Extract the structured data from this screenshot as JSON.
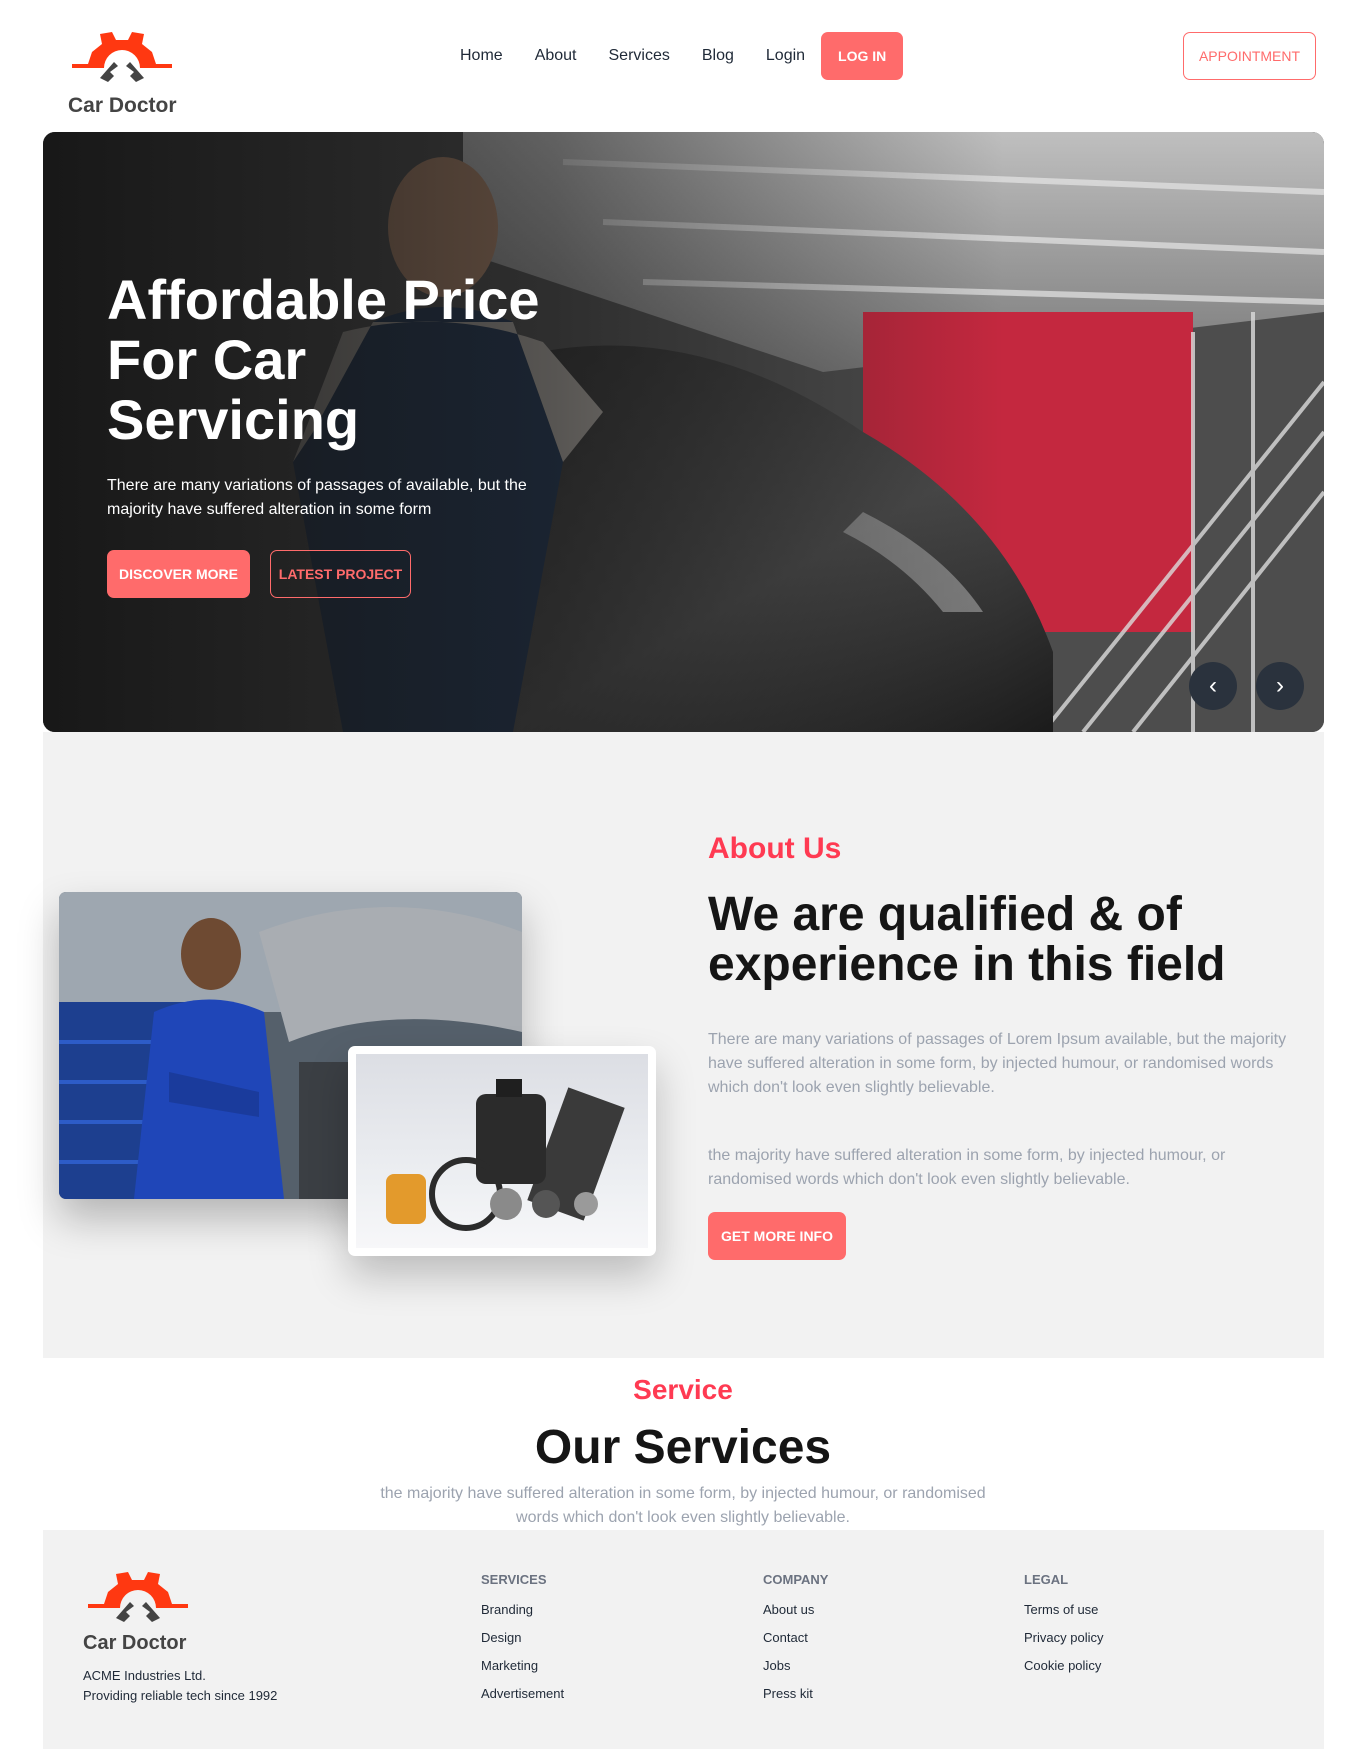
{
  "brand": {
    "name": "Car Doctor",
    "accent": "#ff6b6b",
    "accent_strong": "#ff3a52",
    "logo_color": "#ff3811"
  },
  "nav": {
    "links": [
      "Home",
      "About",
      "Services",
      "Blog",
      "Login"
    ],
    "login_button": "LOG IN",
    "appointment_button": "APPOINTMENT"
  },
  "hero": {
    "title": "Affordable Price For Car Servicing",
    "text": "There are many variations of passages of available, but the majority have suffered alteration in some form",
    "primary_button": "DISCOVER MORE",
    "secondary_button": "LATEST PROJECT",
    "prev_icon": "chevron-left-icon",
    "next_icon": "chevron-right-icon"
  },
  "about": {
    "label": "About Us",
    "title": "We are qualified & of experience in this field",
    "paragraph1": "There are many variations of passages of Lorem Ipsum available, but the majority have suffered alteration in some form, by injected humour, or randomised words which don't look even slightly believable.",
    "paragraph2": "the majority have suffered alteration in some form, by injected humour, or randomised words which don't look even slightly believable.",
    "button": "GET MORE INFO"
  },
  "services": {
    "label": "Service",
    "title": "Our Services",
    "text": "the majority have suffered alteration in some form, by injected humour, or randomised words which don't look even slightly believable."
  },
  "footer": {
    "brand_name": "Car Doctor",
    "company_line1": "ACME Industries Ltd.",
    "company_line2": "Providing reliable tech since 1992",
    "columns": [
      {
        "title": "SERVICES",
        "links": [
          "Branding",
          "Design",
          "Marketing",
          "Advertisement"
        ]
      },
      {
        "title": "COMPANY",
        "links": [
          "About us",
          "Contact",
          "Jobs",
          "Press kit"
        ]
      },
      {
        "title": "LEGAL",
        "links": [
          "Terms of use",
          "Privacy policy",
          "Cookie policy"
        ]
      }
    ]
  }
}
